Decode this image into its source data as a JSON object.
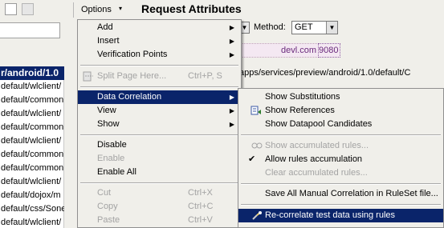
{
  "toolbar": {
    "options_label": "Options",
    "options_arrow": "▾",
    "title": "Request Attributes",
    "icons": [
      "page-icon",
      "edit-icon"
    ]
  },
  "request": {
    "method_label": "Method:",
    "method_value": "GET",
    "host": "devl.com",
    "port": "9080",
    "url_path": "apps/services/preview/android/1.0/default/C"
  },
  "list_items": [
    "r/android/1.0",
    "default/wlclient/",
    "default/common",
    "default/wlclient/",
    "default/common",
    "default/wlclient/",
    "default/common",
    "default/common",
    "default/wlclient/",
    "default/dojox/m",
    "default/css/Sone",
    "default/wlclient/"
  ],
  "main_menu": {
    "add": "Add",
    "insert": "Insert",
    "verification_points": "Verification Points",
    "split_page": "Split Page Here...",
    "split_page_shortcut": "Ctrl+P, S",
    "data_correlation": "Data Correlation",
    "view": "View",
    "show": "Show",
    "disable": "Disable",
    "enable": "Enable",
    "enable_all": "Enable All",
    "cut": "Cut",
    "cut_shortcut": "Ctrl+X",
    "copy": "Copy",
    "copy_shortcut": "Ctrl+C",
    "paste": "Paste",
    "paste_shortcut": "Ctrl+V",
    "submenu_arrow": "▶"
  },
  "data_correlation_submenu": {
    "show_substitutions": "Show Substitutions",
    "show_references": "Show References",
    "show_datapool_candidates": "Show Datapool Candidates",
    "show_accumulated_rules": "Show accumulated rules...",
    "allow_rules_accumulation": "Allow rules accumulation",
    "clear_accumulated_rules": "Clear accumulated rules...",
    "save_all_manual_correlation": "Save All Manual Correlation in RuleSet file...",
    "recorrelate_test_data": "Re-correlate test data using rules",
    "checkmark": "✔"
  }
}
